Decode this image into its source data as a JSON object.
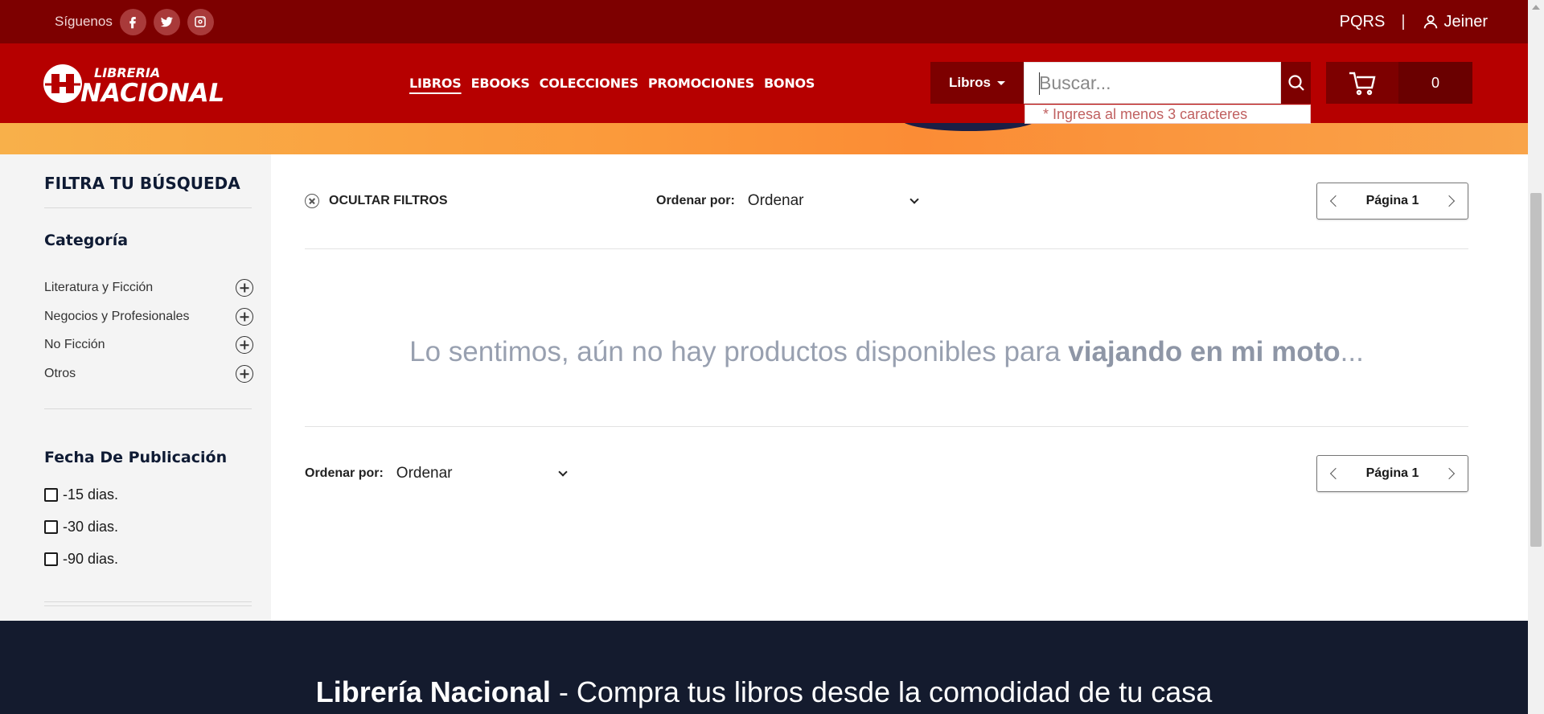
{
  "topbar": {
    "follow_label": "Síguenos",
    "social_icons": [
      "facebook-icon",
      "twitter-icon",
      "instagram-icon"
    ],
    "pqrs": "PQRS",
    "separator": "|",
    "user_name": "Jeiner"
  },
  "header": {
    "logo_top": "LIBRERIA",
    "logo_bottom": "NACIONAL",
    "nav": [
      "LIBROS",
      "EBOOKS",
      "COLECCIONES",
      "PROMOCIONES",
      "BONOS"
    ],
    "category_button": "Libros",
    "search_placeholder": "Buscar...",
    "search_hint": "* Ingresa al menos 3 caracteres",
    "cart_count": "0"
  },
  "sidebar": {
    "title": "FILTRA TU BÚSQUEDA",
    "category_heading": "Categoría",
    "categories": [
      "Literatura y Ficción",
      "Negocios y Profesionales",
      "No Ficción",
      "Otros"
    ],
    "date_heading": "Fecha De Publicación",
    "date_options": [
      "-15 dias.",
      "-30 dias.",
      "-90 dias."
    ]
  },
  "main": {
    "hide_filters": "OCULTAR FILTROS",
    "sort_label": "Ordenar por:",
    "sort_value": "Ordenar",
    "page_label": "Página 1",
    "empty_prefix": "Lo sentimos, aún no hay productos disponibles para ",
    "empty_query": "viajando en mi moto",
    "empty_suffix": "..."
  },
  "footer": {
    "brand": "Librería Nacional",
    "tagline": " - Compra tus libros desde la comodidad de tu casa"
  },
  "colors": {
    "topbar": "#7d0000",
    "header": "#b60000",
    "footer": "#141b2e",
    "banner": "#fb9a3b"
  }
}
